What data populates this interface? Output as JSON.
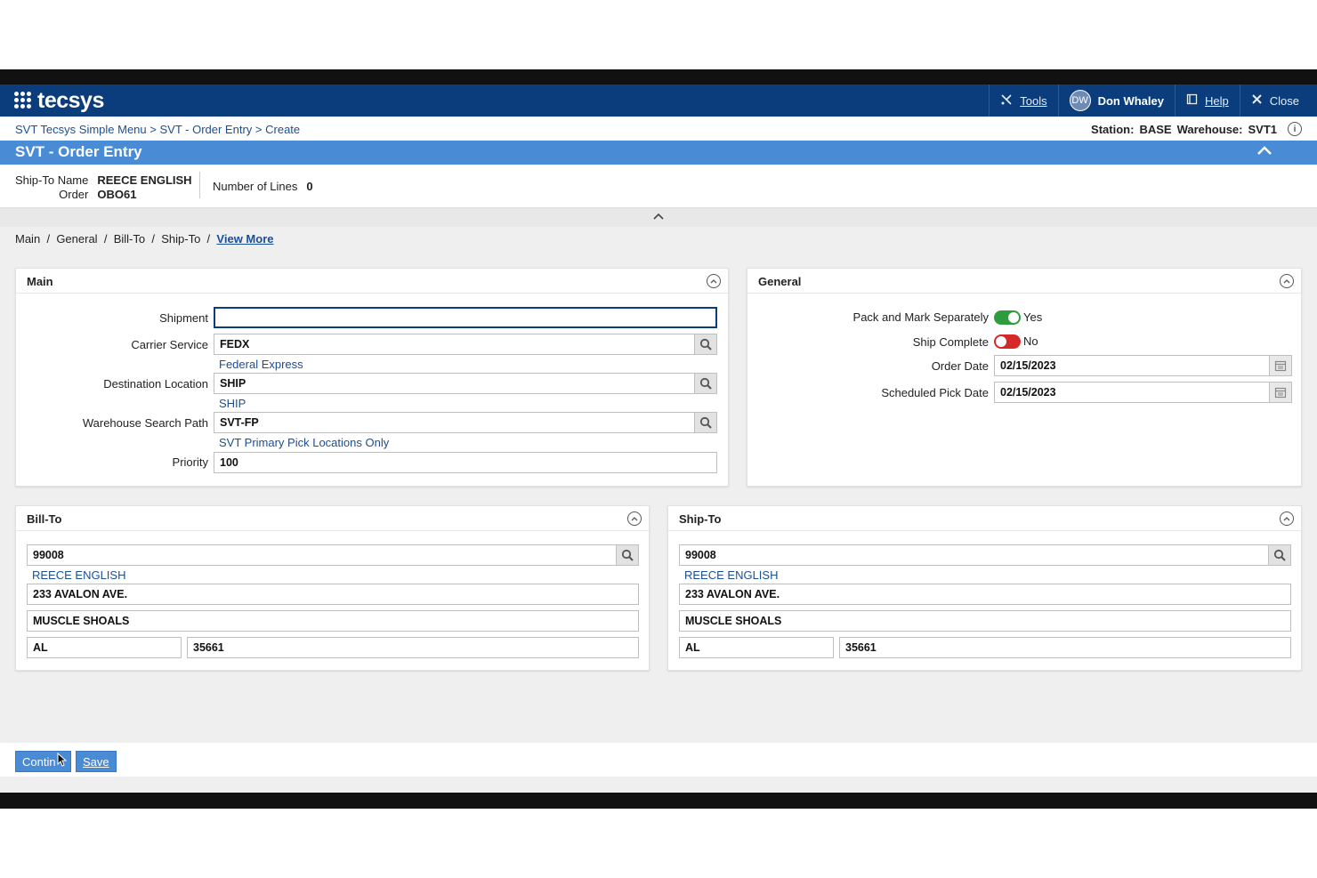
{
  "nav": {
    "logo": "tecsys",
    "tools": "Tools",
    "user_initials": "DW",
    "user_name": "Don Whaley",
    "help": "Help",
    "close": "Close"
  },
  "breadcrumb": {
    "item1": "SVT Tecsys Simple Menu",
    "item2": "SVT - Order Entry",
    "item3": "Create",
    "sep": ">"
  },
  "station": {
    "station_label": "Station:",
    "station_value": "BASE",
    "warehouse_label": "Warehouse:",
    "warehouse_value": "SVT1"
  },
  "page_title": "SVT - Order Entry",
  "summary": {
    "ship_to_name_label": "Ship-To Name",
    "ship_to_name_value": "REECE ENGLISH",
    "order_label": "Order",
    "order_value": "OBO61",
    "lines_label": "Number of Lines",
    "lines_value": "0"
  },
  "section_tabs": {
    "main": "Main",
    "general": "General",
    "bill_to": "Bill-To",
    "ship_to": "Ship-To",
    "sep": "/",
    "view_more": "View More"
  },
  "main_panel": {
    "title": "Main",
    "shipment_label": "Shipment",
    "shipment_value": "",
    "carrier_label": "Carrier Service",
    "carrier_value": "FEDX",
    "carrier_desc": "Federal Express",
    "dest_label": "Destination Location",
    "dest_value": "SHIP",
    "dest_desc": "SHIP",
    "path_label": "Warehouse Search Path",
    "path_value": "SVT-FP",
    "path_desc": "SVT Primary Pick Locations Only",
    "priority_label": "Priority",
    "priority_value": "100"
  },
  "general_panel": {
    "title": "General",
    "pack_label": "Pack and Mark Separately",
    "pack_value": "Yes",
    "ship_complete_label": "Ship Complete",
    "ship_complete_value": "No",
    "order_date_label": "Order Date",
    "order_date_value": "02/15/2023",
    "pick_date_label": "Scheduled Pick Date",
    "pick_date_value": "02/15/2023"
  },
  "bill_to": {
    "title": "Bill-To",
    "customer": "99008",
    "name": "REECE ENGLISH",
    "address": "233 AVALON AVE.",
    "city": "MUSCLE SHOALS",
    "state": "AL",
    "zip": "35661"
  },
  "ship_to": {
    "title": "Ship-To",
    "customer": "99008",
    "name": "REECE ENGLISH",
    "address": "233 AVALON AVE.",
    "city": "MUSCLE SHOALS",
    "state": "AL",
    "zip": "35661"
  },
  "footer": {
    "continue": "Contin",
    "save": "Save"
  },
  "colors": {
    "nav_bg": "#0b3c7c",
    "title_bg": "#4a8bd6",
    "toggle_on": "#2e9c3c",
    "toggle_off": "#d62828"
  }
}
